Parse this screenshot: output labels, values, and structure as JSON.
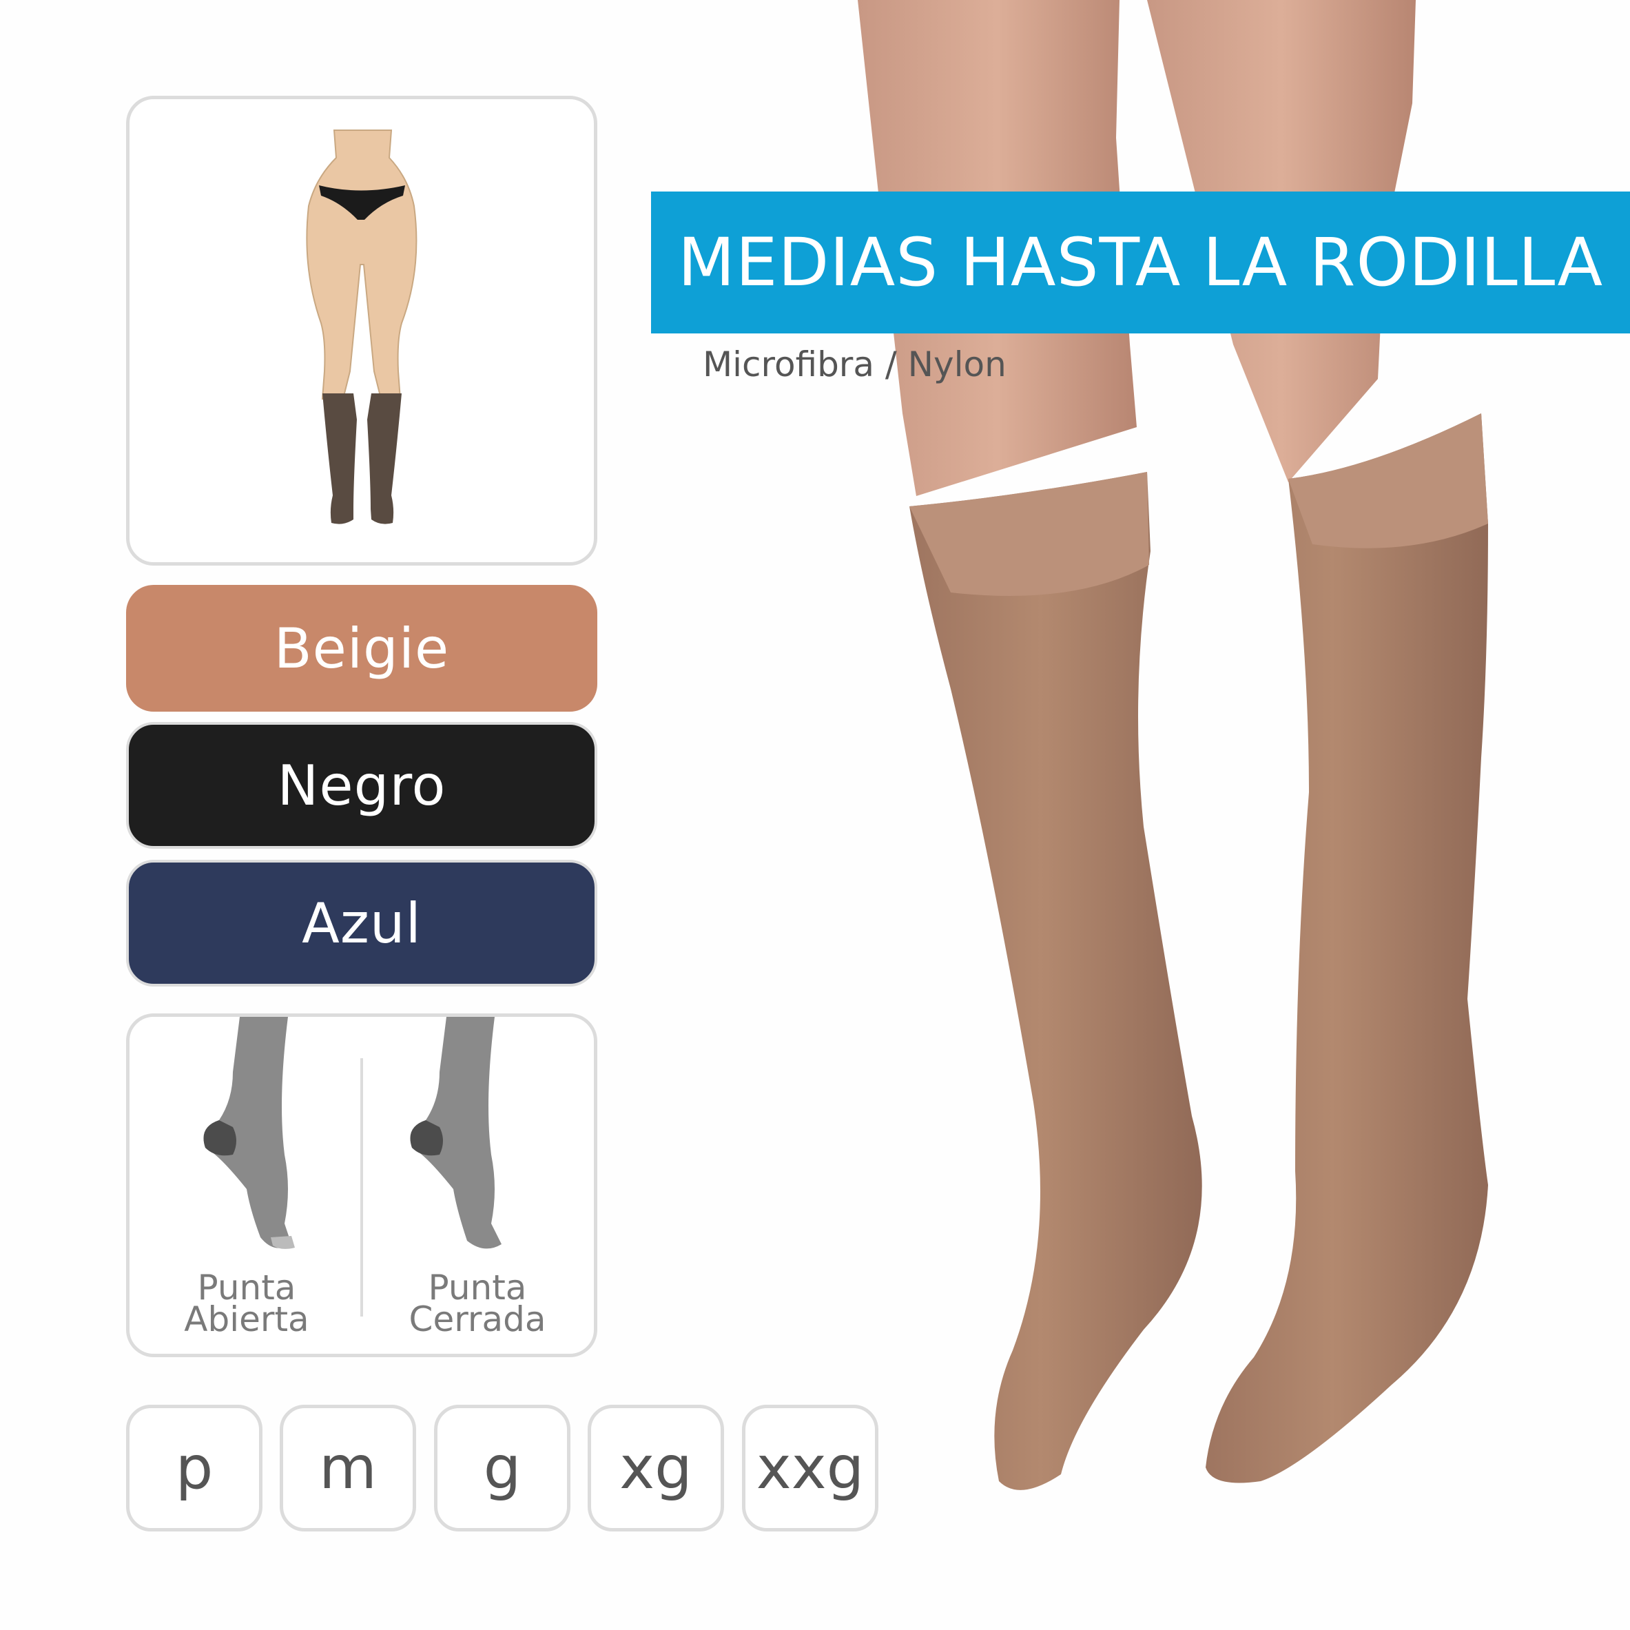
{
  "title": "MEDIAS HASTA LA RODILLA",
  "subtitle": "Microfibra / Nylon",
  "colors": [
    {
      "label": "Beigie",
      "hex": "#c8886a"
    },
    {
      "label": "Negro",
      "hex": "#1e1e1e"
    },
    {
      "label": "Azul",
      "hex": "#2e3a5c"
    }
  ],
  "toe_options": [
    {
      "label": "Punta\nAbierta",
      "icon": "open-toe-sock-icon"
    },
    {
      "label": "Punta\nCerrada",
      "icon": "closed-toe-sock-icon"
    }
  ],
  "sizes": [
    "p",
    "m",
    "g",
    "xg",
    "xxg"
  ],
  "style_icon": "knee-high-stocking-figure-icon",
  "accent_color": "#0ea0d6"
}
